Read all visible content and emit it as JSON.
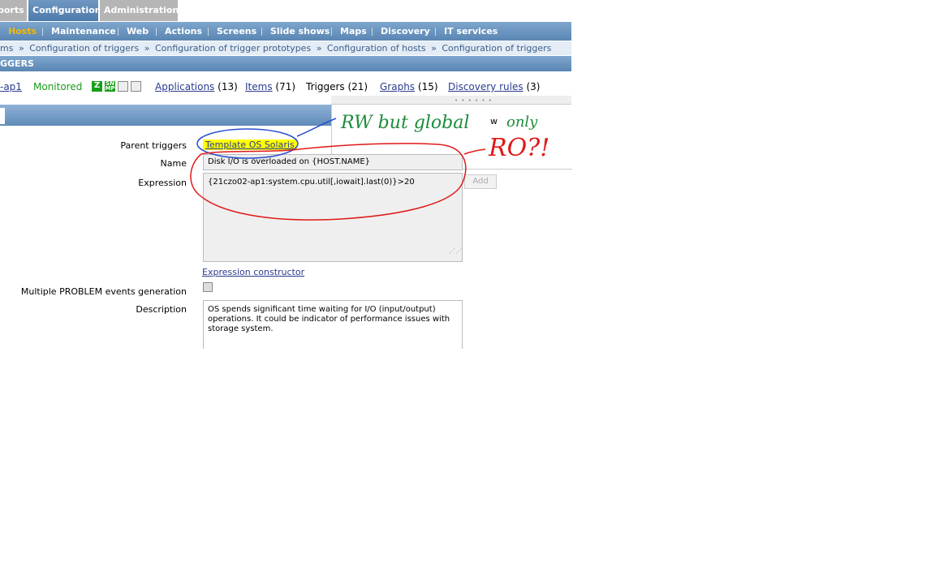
{
  "top_tabs": [
    "ports",
    "Configuration",
    "Administration"
  ],
  "submenu": {
    "items": [
      "Hosts",
      "Maintenance",
      "Web",
      "Actions",
      "Screens",
      "Slide shows",
      "Maps",
      "Discovery",
      "IT services"
    ],
    "active": "Hosts"
  },
  "breadcrumb": [
    "ms",
    "Configuration of triggers",
    "Configuration of trigger prototypes",
    "Configuration of hosts",
    "Configuration of triggers"
  ],
  "breadcrumb_separator": "»",
  "section_title": "GGERS",
  "host_nav": {
    "host": "-ap1",
    "status": "Monitored",
    "badges": [
      "Z",
      "SN MP",
      "",
      ""
    ],
    "applications": {
      "label": "Applications",
      "count": "(13)"
    },
    "items": {
      "label": "Items",
      "count": "(71)"
    },
    "triggers": {
      "label": "Triggers",
      "count": "(21)"
    },
    "graphs": {
      "label": "Graphs",
      "count": "(15)"
    },
    "discovery": {
      "label": "Discovery rules",
      "count": "(3)"
    }
  },
  "form": {
    "parent_triggers_label": "Parent triggers",
    "parent_triggers_value": "Template OS Solaris",
    "name_label": "Name",
    "name_value": "Disk I/O is overloaded on {HOST.NAME}",
    "expression_label": "Expression",
    "expression_value": "{21czo02-ap1:system.cpu.util[,iowait].last(0)}>20",
    "add_button": "Add",
    "expression_constructor": "Expression constructor",
    "multiple_label": "Multiple PROBLEM events generation",
    "multiple_checked": false,
    "description_label": "Description",
    "description_value": "OS spends significant time waiting for I/O (input/output) operations. It could be indicator of performance issues with storage system."
  },
  "annotations": {
    "note1": "RW but global",
    "note1_suffix": "w",
    "note1_tail": "only",
    "note2": "RO?!"
  },
  "colors": {
    "accent_blue": "#5a86b3",
    "active_menu": "#f5b800",
    "highlight": "#ffff00",
    "annotation_green": "#1c8c3a",
    "annotation_red": "#e01818",
    "annotation_blue": "#2a4fd0"
  }
}
